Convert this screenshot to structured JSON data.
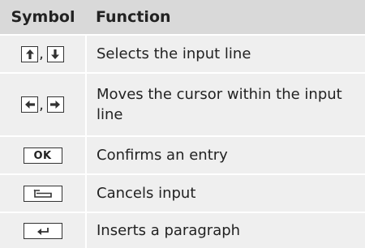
{
  "table": {
    "headers": {
      "symbol": "Symbol",
      "function": "Function"
    },
    "rows": [
      {
        "symbols": [
          "up-arrow-icon",
          "down-arrow-icon"
        ],
        "separator": ",",
        "function": "Selects the input line"
      },
      {
        "symbols": [
          "left-arrow-icon",
          "right-arrow-icon"
        ],
        "separator": ",",
        "function": "Moves the cursor within the input line"
      },
      {
        "symbols": [
          "ok-key"
        ],
        "key_label": "OK",
        "function": "Confirms an entry"
      },
      {
        "symbols": [
          "back-icon"
        ],
        "function": "Cancels input"
      },
      {
        "symbols": [
          "enter-icon"
        ],
        "function": "Inserts a paragraph"
      }
    ]
  }
}
